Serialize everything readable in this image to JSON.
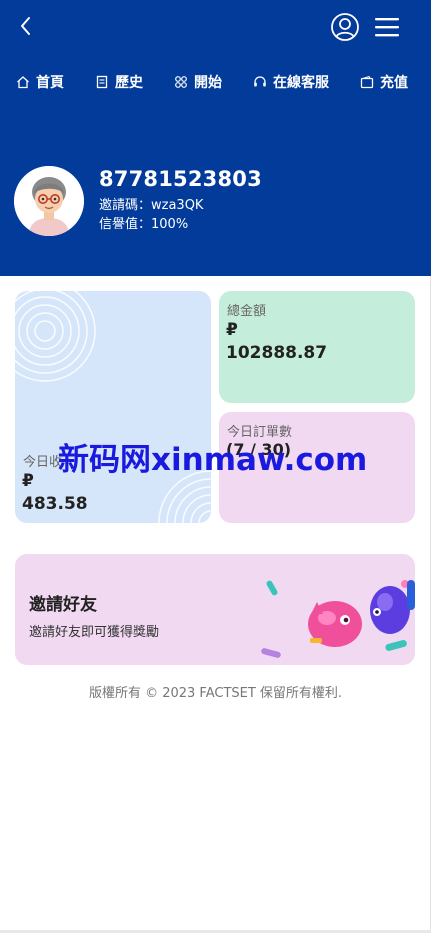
{
  "nav": {
    "items": [
      {
        "label": "首頁",
        "icon": "home-icon"
      },
      {
        "label": "歷史",
        "icon": "document-icon"
      },
      {
        "label": "開始",
        "icon": "grid-icon"
      },
      {
        "label": "在線客服",
        "icon": "headset-icon"
      },
      {
        "label": "充值",
        "icon": "wallet-icon"
      }
    ]
  },
  "profile": {
    "phone": "87781523803",
    "invite_code_line": "邀請碼：wza3QK",
    "credit_line": "信譽值：100%"
  },
  "stats": {
    "today_label": "今日收",
    "today_currency": "₽",
    "today_value": "483.58",
    "total_label": "總金額",
    "total_currency": "₽",
    "total_value": "102888.87",
    "orders_label": "今日訂單數",
    "orders_value": "(7 / 30)"
  },
  "invite": {
    "title": "邀請好友",
    "subtitle": "邀請好友即可獲得獎勵"
  },
  "footer": {
    "copyright": "版權所有 © 2023 FACTSET 保留所有權利."
  },
  "watermark": {
    "text": "新码网xinmaw.com"
  },
  "colors": {
    "header_bg": "#033b9a",
    "card_today_bg": "#d6e6fa",
    "card_total_bg": "#c5eddb",
    "card_orders_bg": "#f2d9f2",
    "invite_bg": "#f2d9f2"
  }
}
